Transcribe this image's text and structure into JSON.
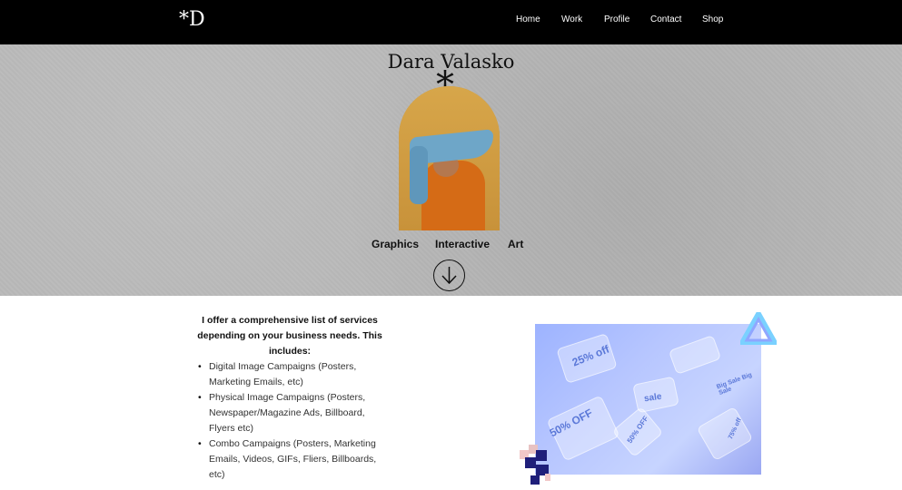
{
  "header": {
    "logo": "*D",
    "nav": [
      "Home",
      "Work",
      "Profile",
      "Contact",
      "Shop"
    ]
  },
  "hero": {
    "name": "Dara Valasko",
    "asterisk": "*",
    "categories": [
      "Graphics",
      "Interactive",
      "Art"
    ]
  },
  "services": {
    "intro": "I offer a comprehensive list of services depending on your business needs. This includes:",
    "items": [
      "Digital Image Campaigns (Posters, Marketing Emails, etc)",
      "Physical Image Campaigns (Posters, Newspaper/Magazine Ads, Billboard, Flyers etc)",
      "Combo Campaigns (Posters, Marketing Emails, Videos, GIFs, Fliers, Billboards, etc)"
    ]
  },
  "sale_image": {
    "tags": [
      "25% off",
      "sale",
      "50% OFF",
      "50% OFF",
      "Big Sale Big Sale",
      "75% off"
    ]
  },
  "colors": {
    "topbar": "#000000",
    "hero_bg": "#b9b9b9",
    "accent_blue": "#9db3ff"
  },
  "icons": {
    "down_arrow": "arrow-down-circle-icon"
  }
}
